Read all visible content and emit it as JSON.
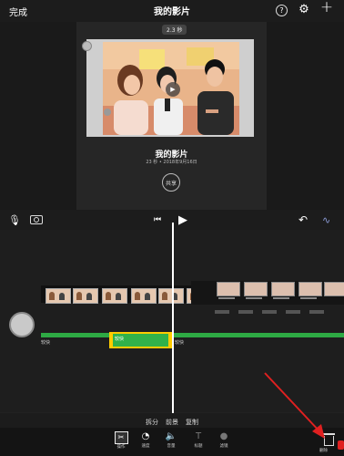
{
  "topbar": {
    "done_label": "完成",
    "title": "我的影片",
    "help_glyph": "?"
  },
  "preview": {
    "duration": "2.3 秒",
    "movie_title": "我的影片",
    "movie_sub": "23 秒 • 2018年9月16日",
    "share_label": "共享"
  },
  "timeline": {
    "clip_label_left": "较快",
    "clip_label_selected": "较快",
    "clip_label_right": "较快"
  },
  "actions": [
    "拆分",
    "前景",
    "复制"
  ],
  "tools": [
    {
      "label": "操作",
      "icon": "scissors-icon"
    },
    {
      "label": "速度",
      "icon": "speedometer-icon"
    },
    {
      "label": "音量",
      "icon": "speaker-icon"
    },
    {
      "label": "标题",
      "icon": "title-icon"
    },
    {
      "label": "滤镜",
      "icon": "filter-icon"
    }
  ],
  "trash_label": "删除",
  "colors": {
    "accent_green": "#2eaa44",
    "selection_yellow": "#ffcc00",
    "annotation_red": "#e02020"
  }
}
